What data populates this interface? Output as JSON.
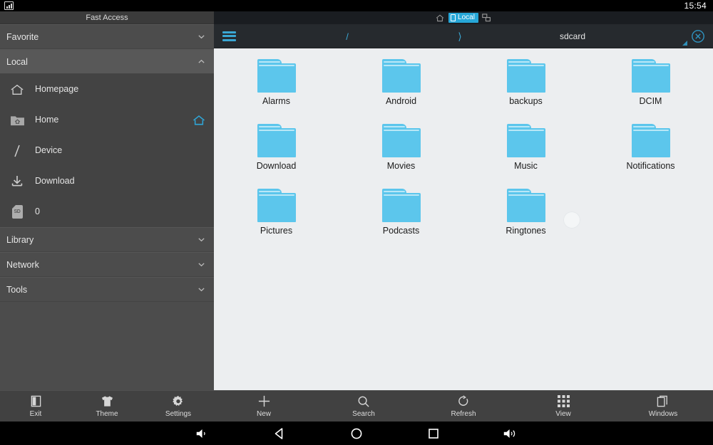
{
  "status_bar": {
    "time": "15:54",
    "notification_icon": "image-icon"
  },
  "sidebar": {
    "header": "Fast Access",
    "groups": [
      {
        "label": "Favorite",
        "state": "collapsed",
        "chevron": "chevron-down-icon"
      },
      {
        "label": "Local",
        "state": "expanded",
        "chevron": "chevron-up-icon"
      },
      {
        "label": "Library",
        "state": "collapsed",
        "chevron": "chevron-down-icon"
      },
      {
        "label": "Network",
        "state": "collapsed",
        "chevron": "chevron-down-icon"
      },
      {
        "label": "Tools",
        "state": "collapsed",
        "chevron": "chevron-down-icon"
      }
    ],
    "local_items": [
      {
        "label": "Homepage",
        "icon": "home-outline-icon",
        "right_icon": ""
      },
      {
        "label": "Home",
        "icon": "folder-home-icon",
        "right_icon": "home-accent-icon"
      },
      {
        "label": "Device",
        "icon": "slash-root-icon",
        "right_icon": ""
      },
      {
        "label": "Download",
        "icon": "download-icon",
        "right_icon": ""
      },
      {
        "label": "0",
        "icon": "sd-card-icon",
        "right_icon": ""
      }
    ],
    "toolbar": [
      {
        "label": "Exit",
        "icon": "exit-door-icon"
      },
      {
        "label": "Theme",
        "icon": "tshirt-icon"
      },
      {
        "label": "Settings",
        "icon": "gear-icon"
      }
    ]
  },
  "main": {
    "tabs": {
      "home_icon": "home-icon",
      "active_tab": "Local",
      "active_tab_icon": "device-icon",
      "split_icon": "split-window-icon"
    },
    "path": {
      "menu_icon": "hamburger-icon",
      "crumbs": [
        "/",
        "⟩",
        "sdcard"
      ],
      "close_icon": "close-circle-icon"
    },
    "files": [
      {
        "name": "Alarms",
        "type": "folder"
      },
      {
        "name": "Android",
        "type": "folder"
      },
      {
        "name": "backups",
        "type": "folder"
      },
      {
        "name": "DCIM",
        "type": "folder"
      },
      {
        "name": "Download",
        "type": "folder"
      },
      {
        "name": "Movies",
        "type": "folder"
      },
      {
        "name": "Music",
        "type": "folder"
      },
      {
        "name": "Notifications",
        "type": "folder"
      },
      {
        "name": "Pictures",
        "type": "folder"
      },
      {
        "name": "Podcasts",
        "type": "folder"
      },
      {
        "name": "Ringtones",
        "type": "folder"
      }
    ],
    "toolbar": [
      {
        "label": "New",
        "icon": "plus-icon"
      },
      {
        "label": "Search",
        "icon": "search-icon"
      },
      {
        "label": "Refresh",
        "icon": "refresh-icon"
      },
      {
        "label": "View",
        "icon": "grid-view-icon"
      },
      {
        "label": "Windows",
        "icon": "windows-stack-icon"
      }
    ]
  },
  "nav_bar": {
    "buttons": [
      {
        "name": "volume-down-icon"
      },
      {
        "name": "back-icon"
      },
      {
        "name": "home-icon"
      },
      {
        "name": "recents-icon"
      },
      {
        "name": "volume-up-icon"
      }
    ]
  },
  "colors": {
    "accent": "#3aa7d4",
    "folder": "#5cc6ec",
    "sidebar_bg": "#4c4c4c",
    "content_bg": "#eceef0"
  }
}
